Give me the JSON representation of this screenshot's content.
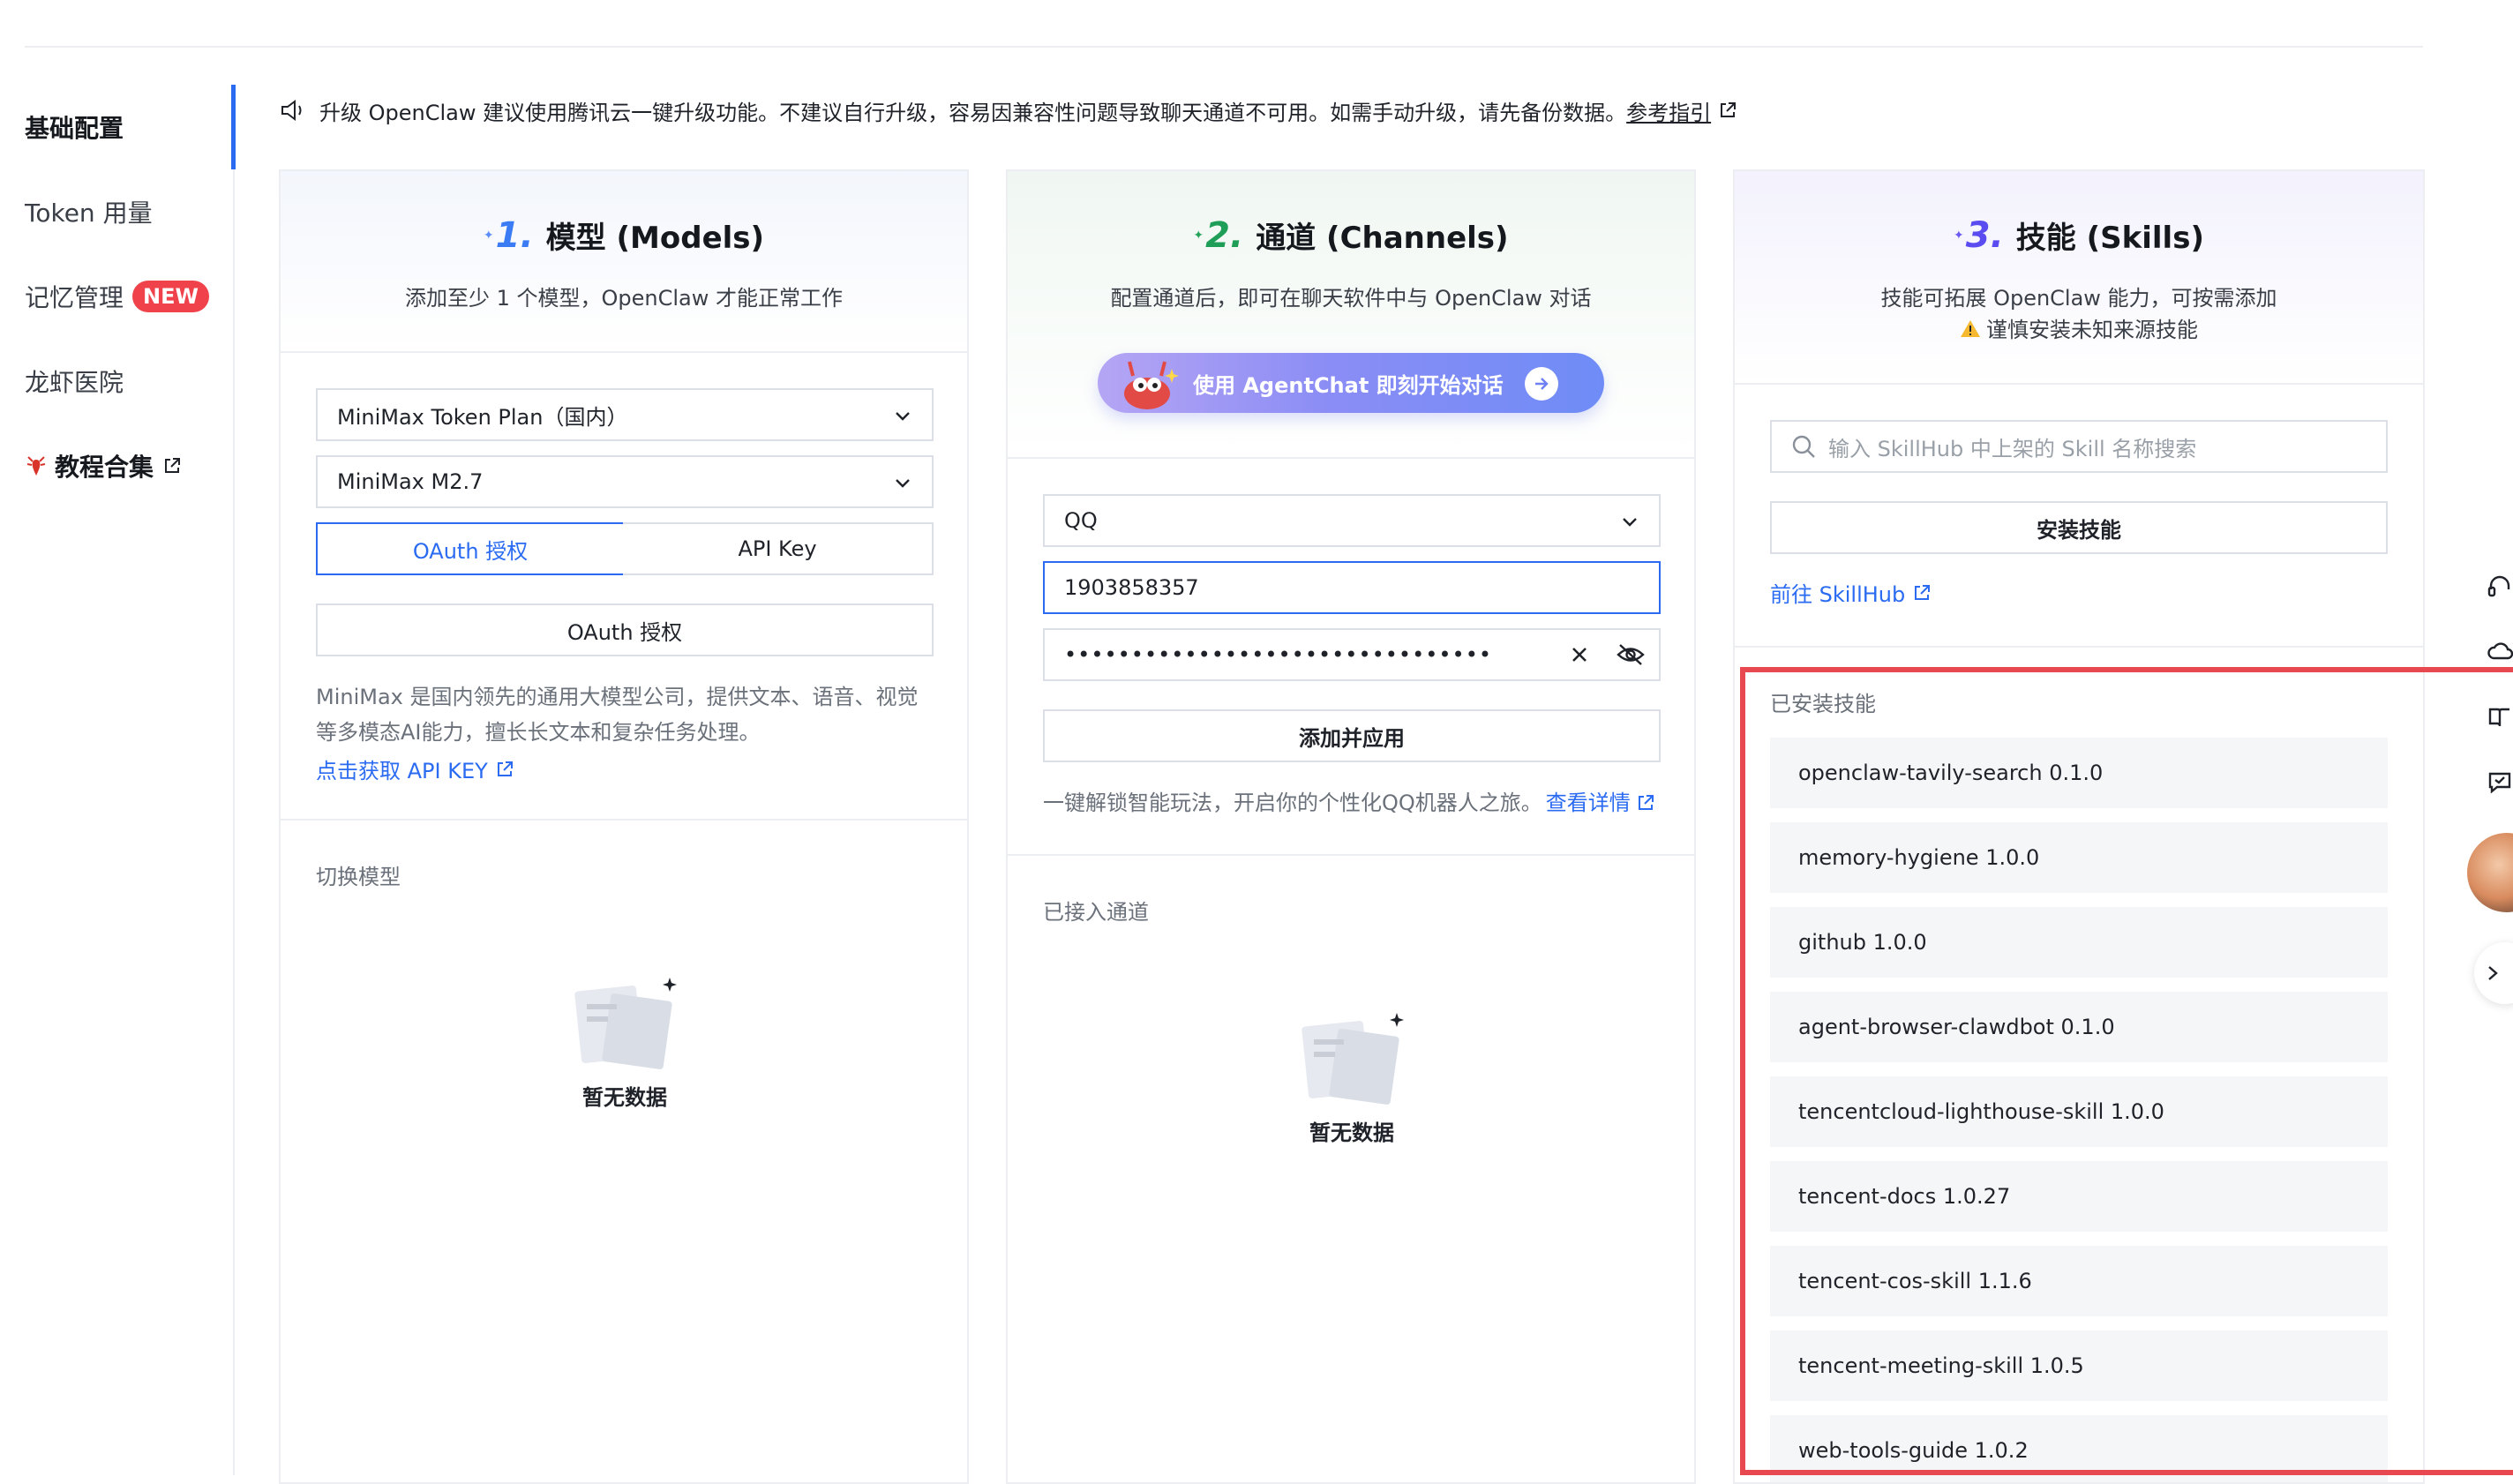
{
  "sidebar": {
    "items": [
      {
        "label": "基础配置"
      },
      {
        "label": "Token 用量"
      },
      {
        "label": "记忆管理",
        "badge": "NEW"
      },
      {
        "label": "龙虾医院"
      },
      {
        "label": "教程合集"
      }
    ]
  },
  "notice": {
    "text": "升级 OpenClaw 建议使用腾讯云一键升级功能。不建议自行升级，容易因兼容性问题导致聊天通道不可用。如需手动升级，请先备份数据。",
    "link": "参考指引"
  },
  "models": {
    "num": "1.",
    "title": "模型 (Models)",
    "subtitle": "添加至少 1 个模型，OpenClaw 才能正常工作",
    "provider_select": "MiniMax Token Plan（国内）",
    "model_select": "MiniMax M2.7",
    "auth_tabs": [
      "OAuth 授权",
      "API Key"
    ],
    "oauth_button": "OAuth 授权",
    "desc_line1": "MiniMax 是国内领先的通用大模型公司，提供文本、语音、视觉",
    "desc_line2": "等多模态AI能力，擅长长文本和复杂任务处理。",
    "api_key_link": "点击获取 API KEY",
    "switch_label": "切换模型",
    "empty_text": "暂无数据"
  },
  "channels": {
    "num": "2.",
    "title": "通道 (Channels)",
    "subtitle": "配置通道后，即可在聊天软件中与 OpenClaw 对话",
    "agentchat_button": "使用 AgentChat 即刻开始对话",
    "channel_select": "QQ",
    "id_value": "1903858357",
    "secret_value": "••••••••••••••••••••••••••••••••",
    "add_button": "添加并应用",
    "promo_text": "一键解锁智能玩法，开启你的个性化QQ机器人之旅。",
    "promo_link": "查看详情",
    "connected_label": "已接入通道",
    "empty_text": "暂无数据"
  },
  "skills": {
    "num": "3.",
    "title": "技能 (Skills)",
    "subtitle1": "技能可拓展 OpenClaw 能力，可按需添加",
    "subtitle2": "谨慎安装未知来源技能",
    "search_placeholder": "输入 SkillHub 中上架的 Skill 名称搜索",
    "install_button": "安装技能",
    "skillhub_link": "前往 SkillHub",
    "installed_label": "已安装技能",
    "installed": [
      "openclaw-tavily-search 0.1.0",
      "memory-hygiene 1.0.0",
      "github 1.0.0",
      "agent-browser-clawdbot 0.1.0",
      "tencentcloud-lighthouse-skill 1.0.0",
      "tencent-docs 1.0.27",
      "tencent-cos-skill 1.1.6",
      "tencent-meeting-skill 1.0.5",
      "web-tools-guide 1.0.2"
    ]
  },
  "colors": {
    "accent": "#2a6bf2",
    "highlight": "#e8484f",
    "badge": "#f0424a"
  }
}
